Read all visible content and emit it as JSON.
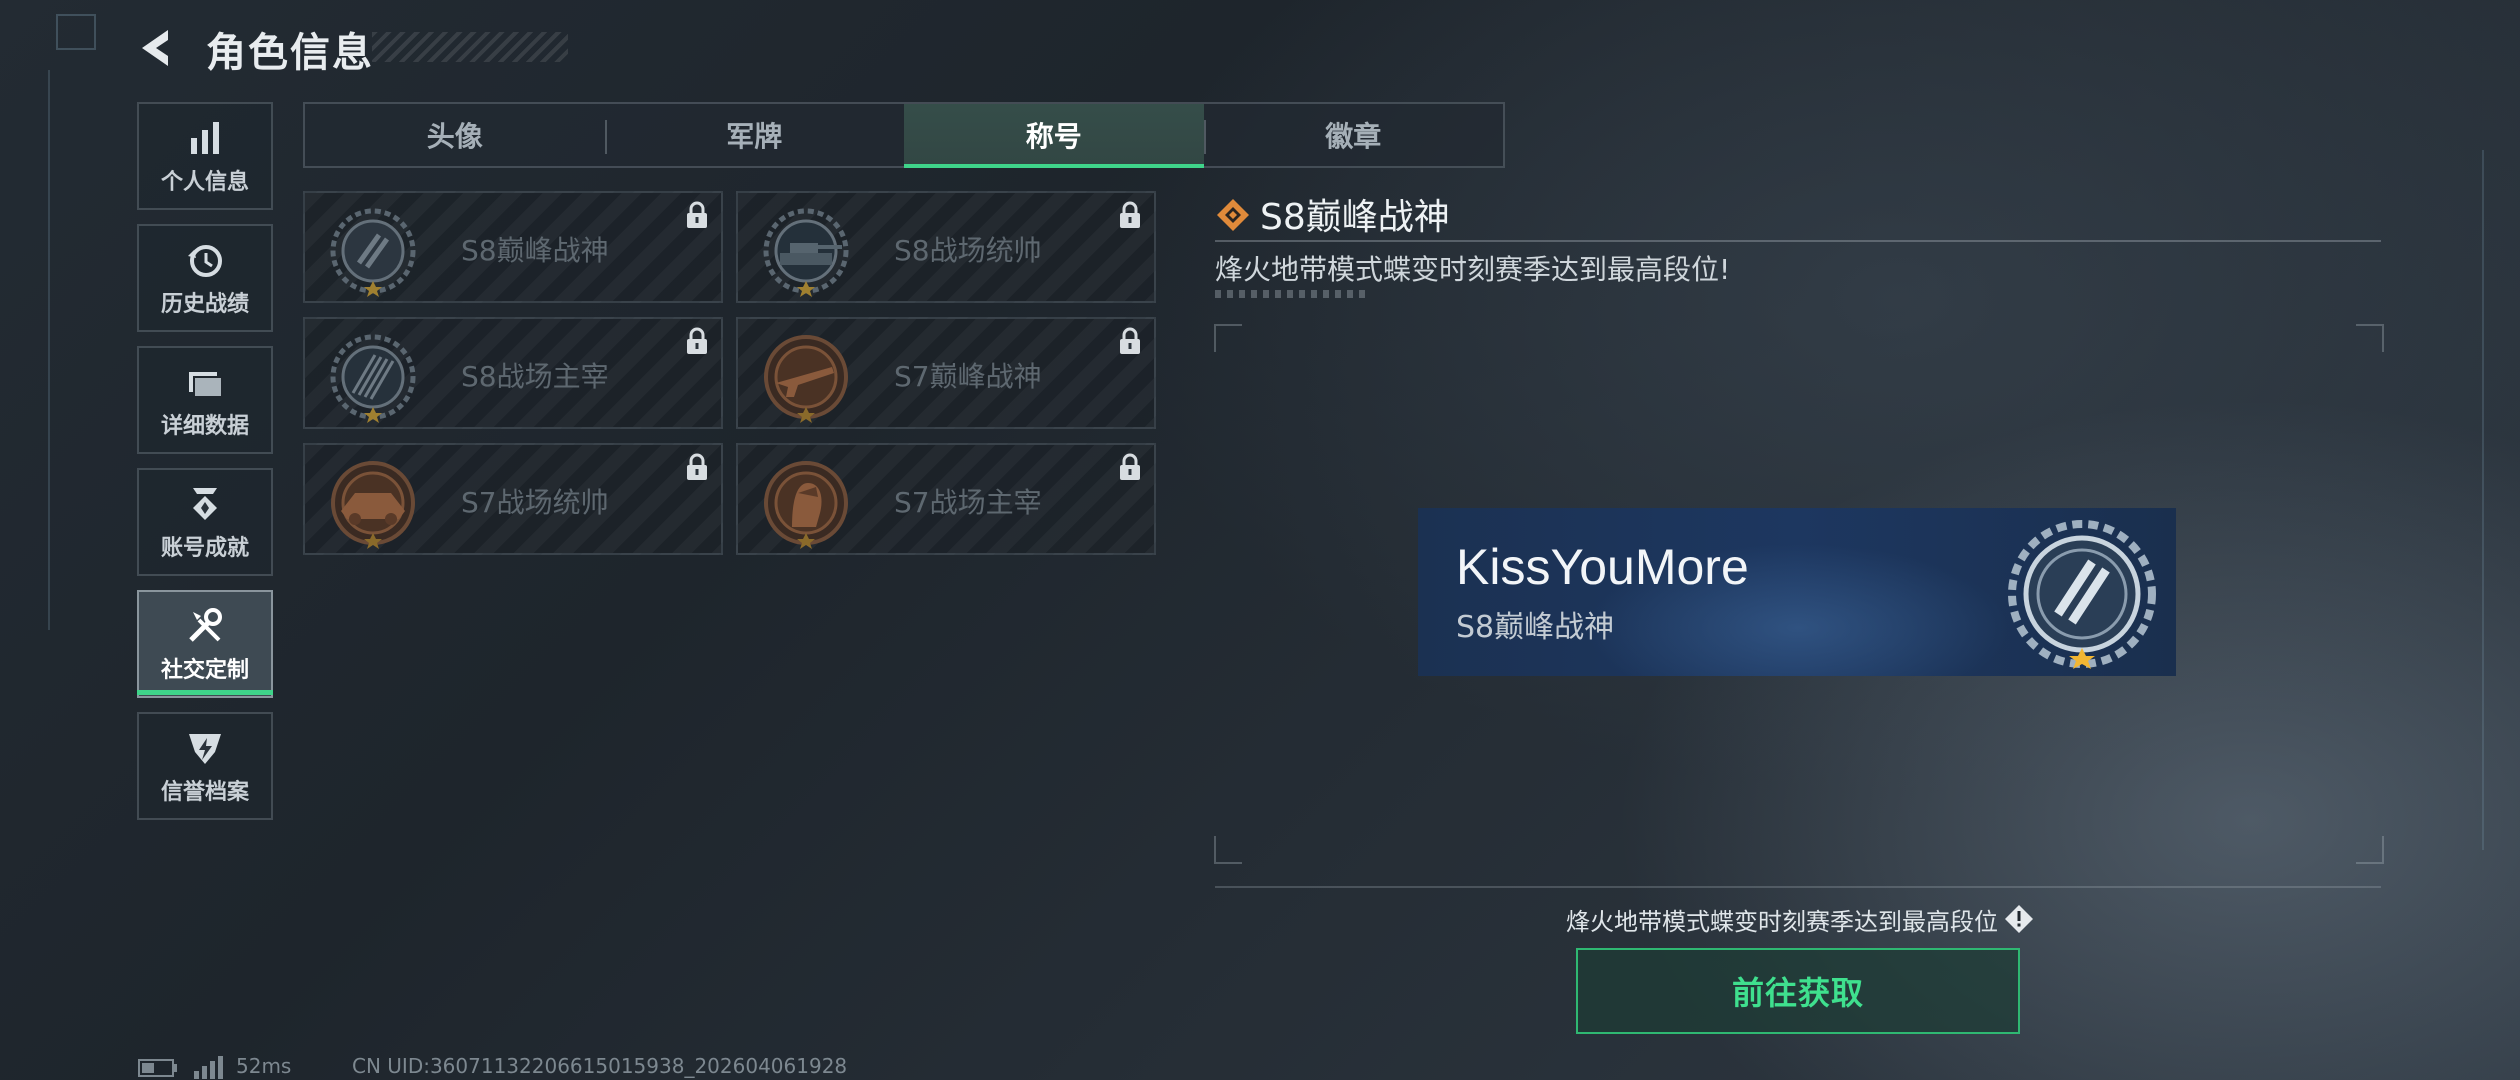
{
  "header": {
    "title": "角色信息",
    "back_icon": "back-arrow-icon"
  },
  "sidebar": {
    "items": [
      {
        "label": "个人信息",
        "icon": "bar-chart-icon",
        "active": false
      },
      {
        "label": "历史战绩",
        "icon": "history-clock-icon",
        "active": false
      },
      {
        "label": "详细数据",
        "icon": "folder-icon",
        "active": false
      },
      {
        "label": "账号成就",
        "icon": "achievement-badge-icon",
        "active": false
      },
      {
        "label": "社交定制",
        "icon": "tools-icon",
        "active": true
      },
      {
        "label": "信誉档案",
        "icon": "shield-lightning-icon",
        "active": false
      }
    ]
  },
  "tabs": [
    {
      "label": "头像",
      "active": false
    },
    {
      "label": "军牌",
      "active": false
    },
    {
      "label": "称号",
      "active": true
    },
    {
      "label": "徽章",
      "active": false
    }
  ],
  "titles": [
    {
      "name": "S8巅峰战神",
      "emblem": "laurel-wreath-emblem-icon",
      "locked": true
    },
    {
      "name": "S8战场统帅",
      "emblem": "tank-emblem-icon",
      "locked": true
    },
    {
      "name": "S8战场主宰",
      "emblem": "missile-rack-emblem-icon",
      "locked": true
    },
    {
      "name": "S7巅峰战神",
      "emblem": "rifle-emblem-icon",
      "locked": true
    },
    {
      "name": "S7战场统帅",
      "emblem": "armored-vehicle-emblem-icon",
      "locked": true
    },
    {
      "name": "S7战场主宰",
      "emblem": "soldier-portrait-emblem-icon",
      "locked": true
    }
  ],
  "detail": {
    "title": "S8巅峰战神",
    "description": "烽火地带模式蝶变时刻赛季达到最高段位!",
    "preview_player": "KissYouMore",
    "preview_title": "S8巅峰战神",
    "requirement": "烽火地带模式蝶变时刻赛季达到最高段位",
    "go_button": "前往获取"
  },
  "footer": {
    "ping": "52ms",
    "uid": "CN UID:360711322066150159 38_202604061928"
  },
  "colors": {
    "accent": "#3fd48a",
    "diamond": "#e08a3a",
    "preview_bg": "#1d3760"
  }
}
